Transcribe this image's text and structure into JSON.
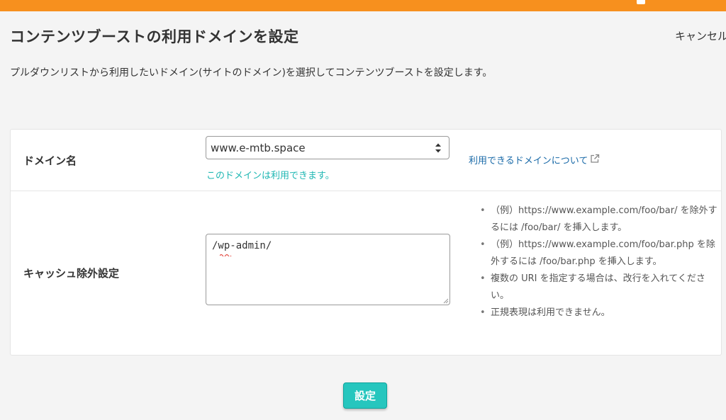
{
  "header": {
    "page_title": "コンテンツブーストの利用ドメインを設定",
    "cancel_label": "キャンセル"
  },
  "description": "プルダウンリストから利用したいドメイン(サイトのドメイン)を選択してコンテンツブーストを設定します。",
  "domain_row": {
    "label": "ドメイン名",
    "selected_domain": "www.e-mtb.space",
    "status_message": "このドメインは利用できます。",
    "help_link_label": "利用できるドメインについて"
  },
  "cache_row": {
    "label": "キャッシュ除外設定",
    "textarea_value": "/wp-admin/",
    "hints": [
      "（例）https://www.example.com/foo/bar/ を除外するには /foo/bar/ を挿入します。",
      "（例）https://www.example.com/foo/bar.php を除外するには /foo/bar.php を挿入します。",
      "複数の URI を指定する場合は、改行を入れてください。",
      "正規表現は利用できません。"
    ]
  },
  "submit_label": "設定",
  "colors": {
    "top_bar": "#f7901e",
    "accent": "#26c6be",
    "status_ok": "#1fb7b3",
    "link": "#1a6aa8"
  },
  "icons": {
    "select_arrows": "up-down-chevron-icon",
    "external_link": "external-link-icon"
  }
}
